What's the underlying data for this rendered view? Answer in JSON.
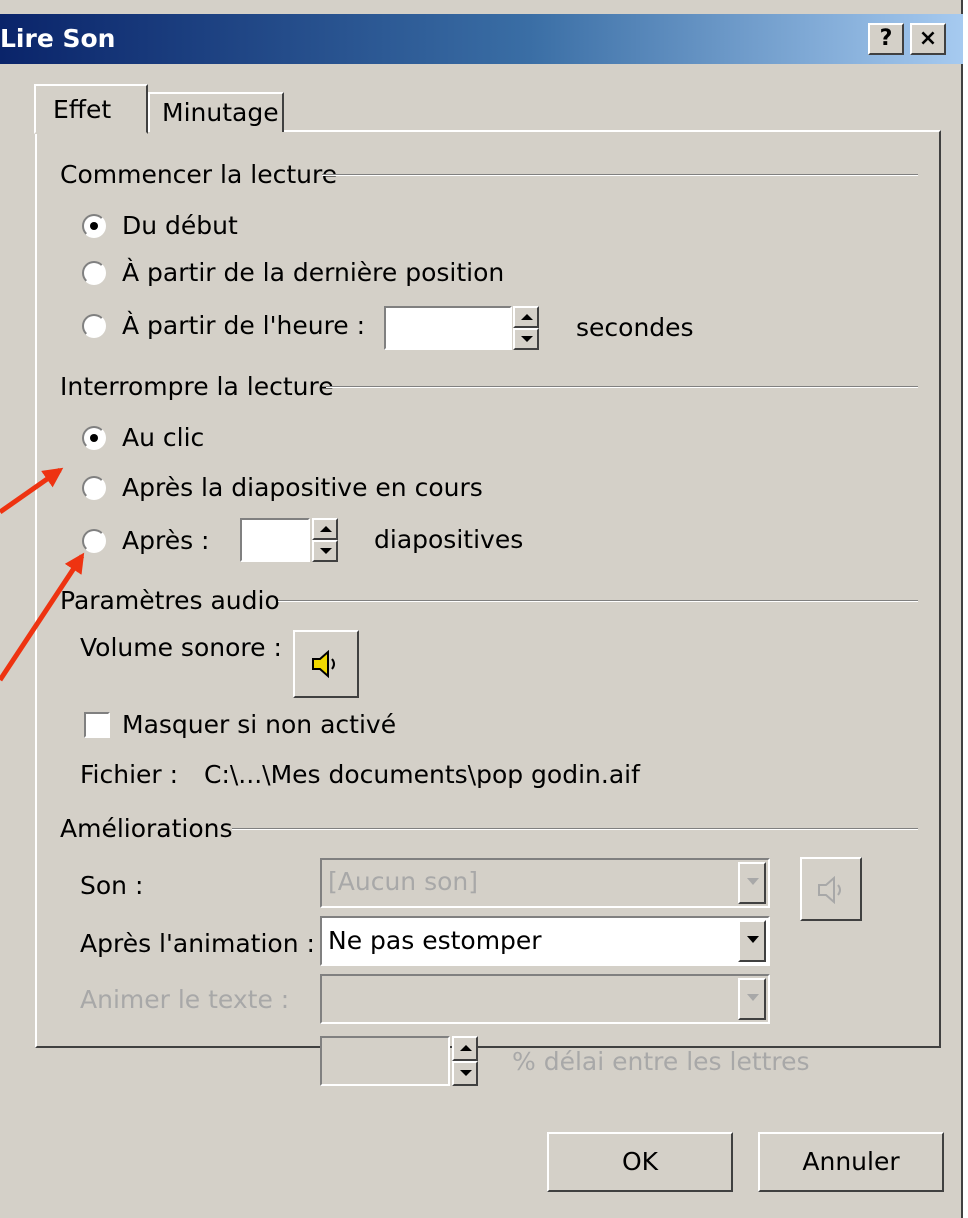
{
  "window": {
    "title": "Lire Son",
    "help_label": "?",
    "close_label": "×"
  },
  "tabs": [
    {
      "label": "Effet",
      "active": true
    },
    {
      "label": "Minutage",
      "active": false
    }
  ],
  "start_group": {
    "title": "Commencer la lecture",
    "options": [
      {
        "label": "Du début",
        "selected": true
      },
      {
        "label": "À partir de la dernière position",
        "selected": false
      },
      {
        "label": "À partir de l'heure :",
        "selected": false
      }
    ],
    "time_value": "",
    "time_unit": "secondes"
  },
  "stop_group": {
    "title": "Interrompre la lecture",
    "options": [
      {
        "label": "Au clic",
        "selected": true
      },
      {
        "label": "Après la diapositive en cours",
        "selected": false
      },
      {
        "label": "Après :",
        "selected": false
      }
    ],
    "slides_value": "",
    "slides_unit": "diapositives"
  },
  "audio_group": {
    "title": "Paramètres audio",
    "volume_label": "Volume sonore :",
    "hide_label": "Masquer si non activé",
    "hide_checked": false,
    "file_label": "Fichier :",
    "file_path": "C:\\...\\Mes documents\\pop godin.aif"
  },
  "enhancements": {
    "title": "Améliorations",
    "sound_label": "Son :",
    "sound_value": "[Aucun son]",
    "after_anim_label": "Après l'animation :",
    "after_anim_value": "Ne pas estomper",
    "animate_text_label": "Animer le texte :",
    "animate_text_value": "",
    "delay_value": "",
    "delay_label": "% délai entre les lettres"
  },
  "buttons": {
    "ok": "OK",
    "cancel": "Annuler"
  },
  "annotation_color": "#ee3311",
  "icons": {
    "speaker": "speaker-icon"
  }
}
